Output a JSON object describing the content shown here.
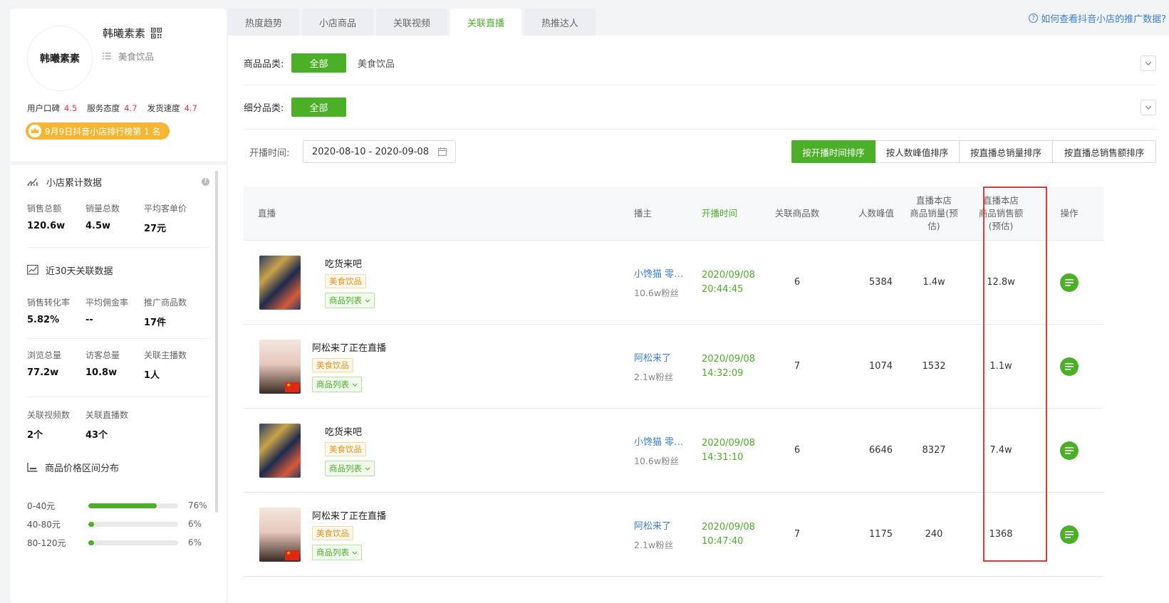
{
  "shop": {
    "logo_text": "韩曦素素",
    "name": "韩曦素素",
    "category": "美食饮品",
    "ratings": [
      {
        "label": "用户口碑",
        "value": "4.5"
      },
      {
        "label": "服务态度",
        "value": "4.7"
      },
      {
        "label": "发货速度",
        "value": "4.7"
      }
    ],
    "rank_badge": "9月9日抖音小店排行榜第 1 名"
  },
  "sidebar": {
    "cumulative_title": "小店累计数据",
    "cumulative": [
      {
        "label": "销售总额",
        "value": "120.6w"
      },
      {
        "label": "销量总数",
        "value": "4.5w"
      },
      {
        "label": "平均客单价",
        "value": "27元"
      }
    ],
    "recent_title": "近30天关联数据",
    "recent_row1": [
      {
        "label": "销售转化率",
        "value": "5.82%"
      },
      {
        "label": "平均佣金率",
        "value": "--"
      },
      {
        "label": "推广商品数",
        "value": "17件"
      }
    ],
    "recent_row2": [
      {
        "label": "浏览总量",
        "value": "77.2w"
      },
      {
        "label": "访客总量",
        "value": "10.8w"
      },
      {
        "label": "关联主播数",
        "value": "1人"
      }
    ],
    "recent_row3": [
      {
        "label": "关联视频数",
        "value": "2个"
      },
      {
        "label": "关联直播数",
        "value": "43个"
      }
    ],
    "price_title": "商品价格区间分布",
    "price_ranges": [
      {
        "label": "0-40元",
        "pct_text": "76%",
        "pct": 76
      },
      {
        "label": "40-80元",
        "pct_text": "6%",
        "pct": 6
      },
      {
        "label": "80-120元",
        "pct_text": "6%",
        "pct": 6
      }
    ]
  },
  "tabs": [
    {
      "label": "热度趋势",
      "active": false
    },
    {
      "label": "小店商品",
      "active": false
    },
    {
      "label": "关联视频",
      "active": false
    },
    {
      "label": "关联直播",
      "active": true
    },
    {
      "label": "热推达人",
      "active": false
    }
  ],
  "help_link": "如何查看抖音小店的推广数据?",
  "filters": {
    "category_label": "商品品类:",
    "category_all": "全部",
    "category_option": "美食饮品",
    "sub_label": "细分品类:",
    "sub_all": "全部"
  },
  "date": {
    "label": "开播时间:",
    "range": "2020-08-10 - 2020-09-08"
  },
  "sort_buttons": [
    {
      "label": "按开播时间排序",
      "active": true
    },
    {
      "label": "按人数峰值排序",
      "active": false
    },
    {
      "label": "按直播总销量排序",
      "active": false
    },
    {
      "label": "按直播总销售额排序",
      "active": false
    }
  ],
  "table": {
    "headers": {
      "live": "直播",
      "anchor": "播主",
      "time": "开播时间",
      "goods": "关联商品数",
      "peak": "人数峰值",
      "sales_l1": "直播本店",
      "sales_l2": "商品销量(预",
      "sales_l3": "估)",
      "amount_l1": "直播本店",
      "amount_l2": "商品销售额",
      "amount_l3": "(预估)",
      "op": "操作"
    },
    "rows": [
      {
        "title": "吃货来吧",
        "tag": "美食饮品",
        "list": "商品列表",
        "anchor": "小馋猫 零食铺",
        "fans": "10.6w粉丝",
        "date": "2020/09/08",
        "time": "20:44:45",
        "goods": "6",
        "peak": "5384",
        "sales": "1.4w",
        "amount": "12.8w"
      },
      {
        "title": "阿松来了正在直播",
        "tag": "美食饮品",
        "list": "商品列表",
        "anchor": "阿松来了",
        "fans": "2.1w粉丝",
        "date": "2020/09/08",
        "time": "14:32:09",
        "goods": "7",
        "peak": "1074",
        "sales": "1532",
        "amount": "1.1w"
      },
      {
        "title": "吃货来吧",
        "tag": "美食饮品",
        "list": "商品列表",
        "anchor": "小馋猫 零食铺",
        "fans": "10.6w粉丝",
        "date": "2020/09/08",
        "time": "14:31:10",
        "goods": "6",
        "peak": "6646",
        "sales": "8327",
        "amount": "7.4w"
      },
      {
        "title": "阿松来了正在直播",
        "tag": "美食饮品",
        "list": "商品列表",
        "anchor": "阿松来了",
        "fans": "2.1w粉丝",
        "date": "2020/09/08",
        "time": "10:47:40",
        "goods": "7",
        "peak": "1175",
        "sales": "240",
        "amount": "1368"
      }
    ]
  },
  "colors": {
    "accent_green": "#4caf28",
    "rating_red": "#e8334a",
    "link_blue": "#3b7fd8",
    "highlight_red": "#e53935"
  }
}
